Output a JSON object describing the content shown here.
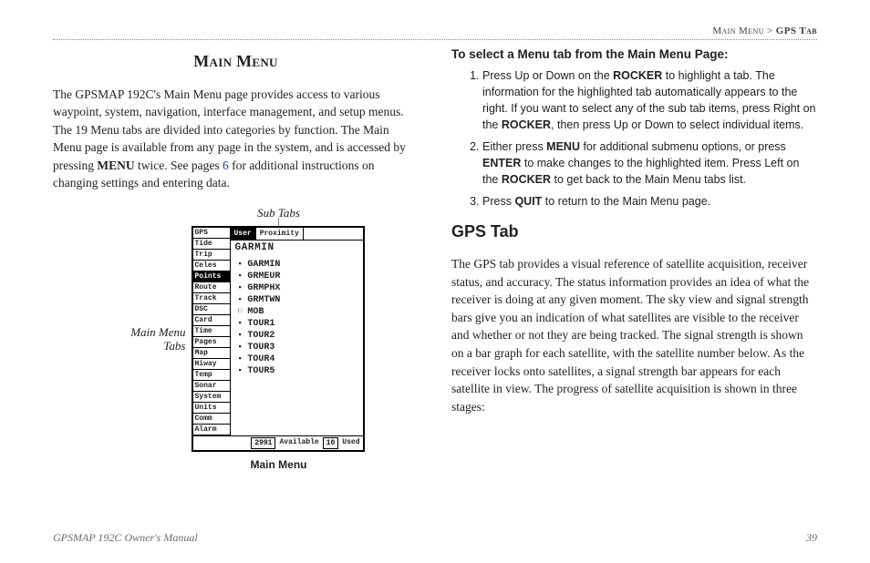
{
  "breadcrumb": {
    "section": "Main Menu",
    "sep": " > ",
    "tab": "GPS Tab"
  },
  "left": {
    "heading": "Main Menu",
    "para_segments": [
      "The GPSMAP 192C's Main Menu page provides access to various waypoint, system, navigation, interface management, and setup menus. The 19 Menu tabs are divided into categories by function. The Main Menu page is available from any page in the system, and is accessed by pressing ",
      "MENU",
      " twice. See pages ",
      "6",
      " for additional instructions on changing settings and entering data."
    ],
    "figure": {
      "top_label": "Sub Tabs",
      "side_label": "Main Menu\nTabs",
      "caption": "Main Menu",
      "tabs": [
        "GPS",
        "Tide",
        "Trip",
        "Celes",
        "Points",
        "Route",
        "Track",
        "DSC",
        "Card",
        "Time",
        "Pages",
        "Map",
        "Hiway",
        "Temp",
        "Sonar",
        "System",
        "Units",
        "Comm",
        "Alarm"
      ],
      "selected_tab_index": 4,
      "subtabs": [
        "User",
        "Proximity"
      ],
      "selected_subtab_index": 0,
      "brand": "GARMIN",
      "waypoints": [
        {
          "name": "GARMIN",
          "flag": false
        },
        {
          "name": "GRMEUR",
          "flag": false
        },
        {
          "name": "GRMPHX",
          "flag": false
        },
        {
          "name": "GRMTWN",
          "flag": false
        },
        {
          "name": "MOB",
          "flag": true
        },
        {
          "name": "TOUR1",
          "flag": false
        },
        {
          "name": "TOUR2",
          "flag": false
        },
        {
          "name": "TOUR3",
          "flag": false
        },
        {
          "name": "TOUR4",
          "flag": false
        },
        {
          "name": "TOUR5",
          "flag": false
        }
      ],
      "status": {
        "available_value": "2991",
        "available_label": "Available",
        "used_value": "10",
        "used_label": "Used"
      }
    }
  },
  "right": {
    "proc_title": "To select a Menu tab from the Main Menu Page:",
    "steps": [
      {
        "parts": [
          "Press Up or Down on the ",
          {
            "b": "ROCKER"
          },
          " to highlight a tab. The information for the highlighted tab automatically appears to the right. If you want to select any of the sub tab items, press Right on the ",
          {
            "b": "ROCKER"
          },
          ", then press Up or Down to select individual items."
        ]
      },
      {
        "parts": [
          "Either press ",
          {
            "b": "MENU"
          },
          " for additional submenu options, or press ",
          {
            "b": "ENTER"
          },
          " to make changes to the highlighted item. Press Left on the ",
          {
            "b": "ROCKER"
          },
          " to get back to the Main Menu tabs list."
        ]
      },
      {
        "parts": [
          "Press ",
          {
            "b": "QUIT"
          },
          " to return to the Main Menu page."
        ]
      }
    ],
    "section_heading": "GPS Tab",
    "body": "The GPS tab provides a visual reference of satellite acquisition, receiver status, and accuracy. The status information provides an idea of what the receiver is doing at any given moment. The sky view and signal strength bars give you an indication of what satellites are visible to the receiver and whether or not they are being tracked. The signal strength is shown on a bar graph for each satellite, with the satellite number below. As the receiver locks onto satellites, a signal strength bar appears for each satellite in view. The progress of satellite acquisition is shown in three stages:"
  },
  "footer": {
    "left": "GPSMAP 192C Owner's Manual",
    "right": "39"
  }
}
